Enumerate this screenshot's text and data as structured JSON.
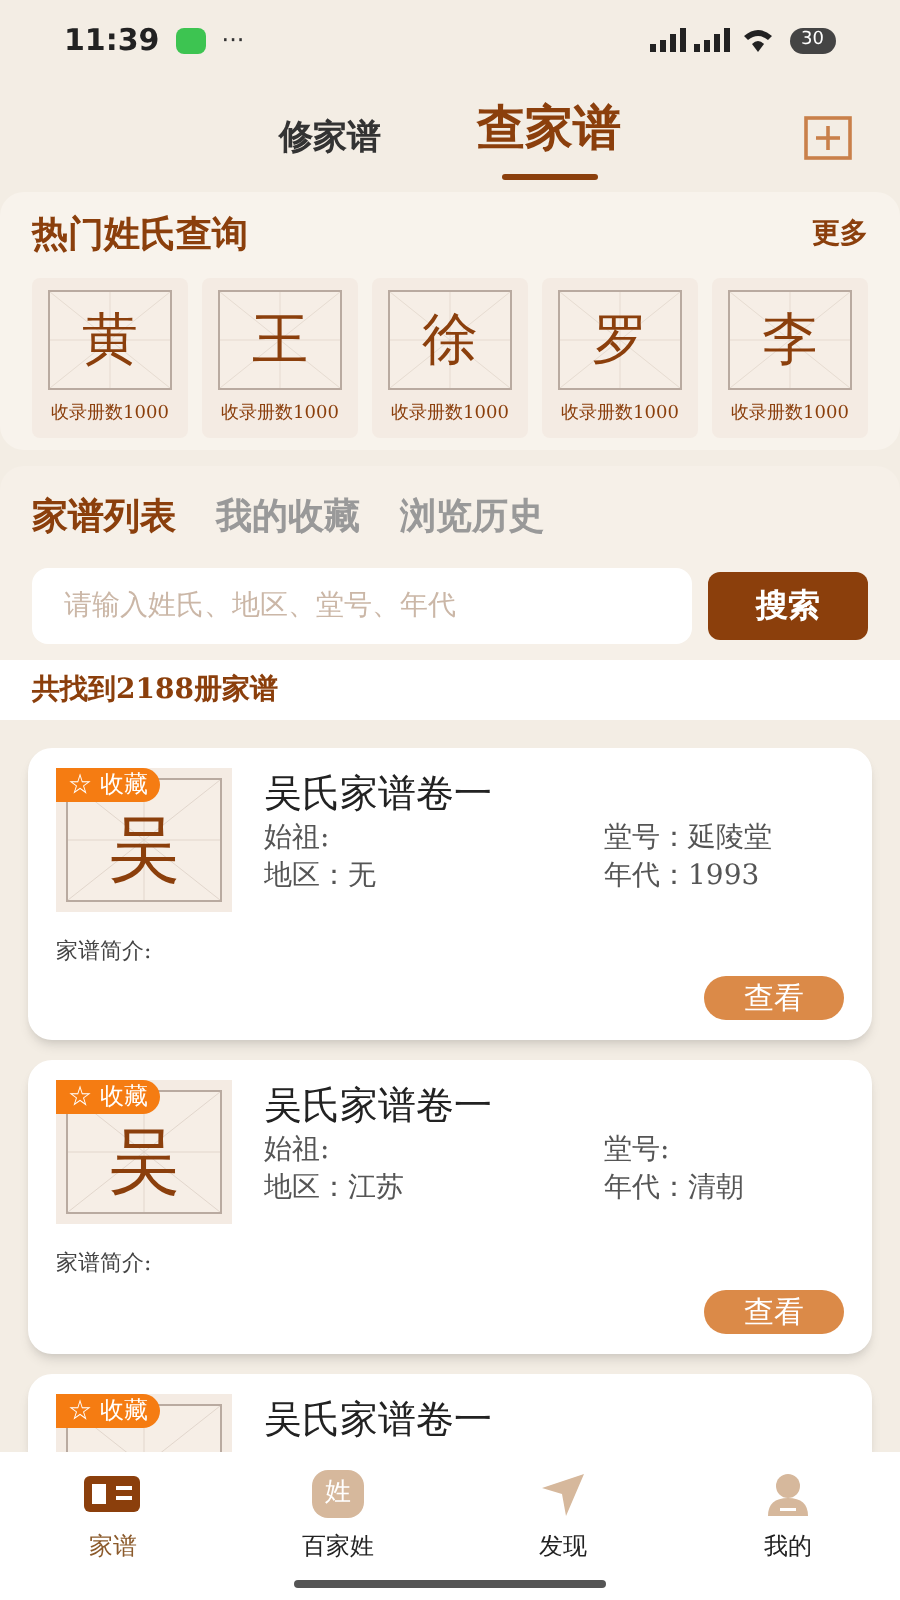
{
  "status_bar": {
    "time": "11:39",
    "more": "···",
    "battery": "30"
  },
  "header_tabs": [
    {
      "label": "修家谱",
      "selected": false
    },
    {
      "label": "查家谱",
      "selected": true
    }
  ],
  "hot_surnames": {
    "title": "热门姓氏查询",
    "more": "更多",
    "items": [
      {
        "char": "黄",
        "count": "收录册数1000"
      },
      {
        "char": "王",
        "count": "收录册数1000"
      },
      {
        "char": "徐",
        "count": "收录册数1000"
      },
      {
        "char": "罗",
        "count": "收录册数1000"
      },
      {
        "char": "李",
        "count": "收录册数1000"
      }
    ]
  },
  "list_tabs": [
    {
      "label": "家谱列表",
      "selected": true
    },
    {
      "label": "我的收藏",
      "selected": false
    },
    {
      "label": "浏览历史",
      "selected": false
    }
  ],
  "search": {
    "placeholder": "请输入姓氏、地区、堂号、年代",
    "button": "搜索"
  },
  "result_count": "共找到2188册家谱",
  "records": [
    {
      "badge": "☆ 收藏",
      "char": "吴",
      "title": "吴氏家谱卷一",
      "founder": "始祖:",
      "hall": "堂号：延陵堂",
      "region": "地区：无",
      "era": "年代：1993",
      "intro": "家谱简介:",
      "view": "查看"
    },
    {
      "badge": "☆ 收藏",
      "char": "吴",
      "title": "吴氏家谱卷一",
      "founder": "始祖:",
      "hall": "堂号:",
      "region": "地区：江苏",
      "era": "年代：清朝",
      "intro": "家谱简介:",
      "view": "查看"
    },
    {
      "badge": "☆ 收藏",
      "title": "吴氏家谱卷一"
    }
  ],
  "nav": [
    {
      "label": "家谱",
      "kind": "book",
      "selected": true
    },
    {
      "label": "百家姓",
      "kind": "surname",
      "glyph": "姓",
      "selected": false
    },
    {
      "label": "发现",
      "kind": "plane",
      "selected": false
    },
    {
      "label": "我的",
      "kind": "person",
      "selected": false
    }
  ]
}
